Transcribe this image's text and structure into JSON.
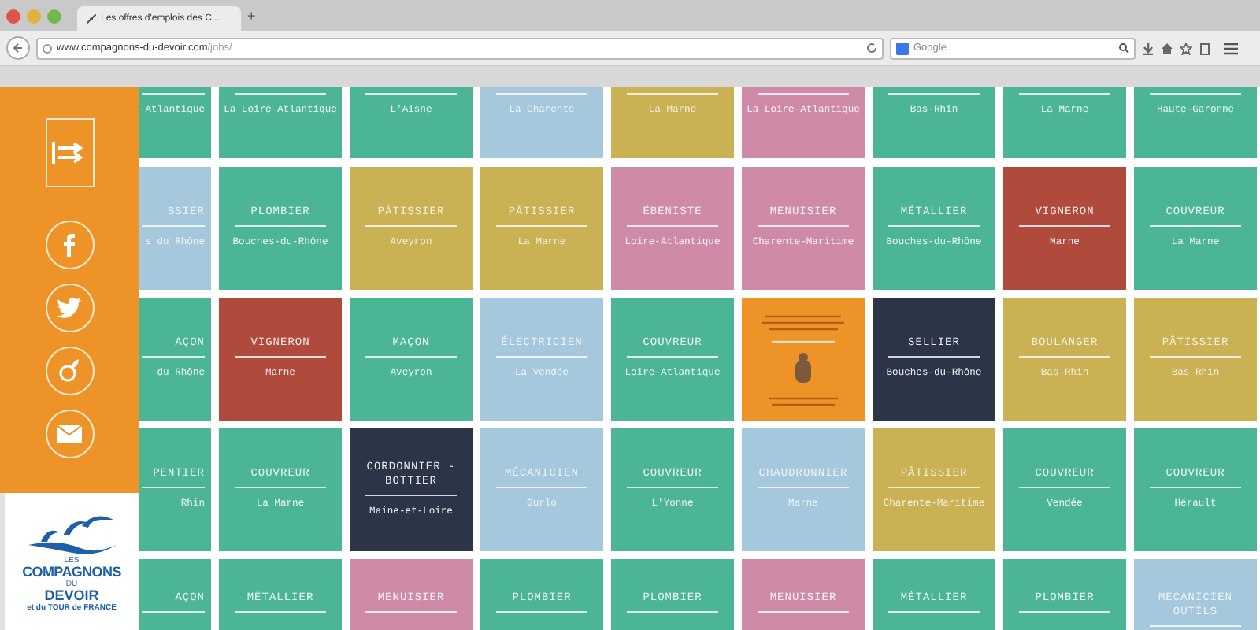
{
  "browser": {
    "tab_title": "Les offres d'emplois des C...",
    "new_tab": "+",
    "url_host": "www.compagnons-du-devoir.com",
    "url_path": "/jobs/",
    "search_placeholder": "Google"
  },
  "logo": {
    "lines": [
      "LES",
      "COMPAGNONS",
      "DU",
      "DEVOIR",
      "et du TOUR de FRANCE"
    ]
  },
  "rows": [
    {
      "kind": "bottom",
      "tiles": [
        {
          "kind": "job",
          "region": "-Atlantique",
          "color": "#4bb596"
        },
        {
          "kind": "job",
          "region": "La Loire-Atlantique",
          "color": "#4bb596"
        },
        {
          "kind": "job",
          "region": "L'Aisne",
          "color": "#4bb596"
        },
        {
          "kind": "job",
          "region": "La Charente",
          "color": "#a5c8dc"
        },
        {
          "kind": "job",
          "region": "La Marne",
          "color": "#c9b154"
        },
        {
          "kind": "job",
          "region": "La Loire-Atlantique",
          "color": "#cf8aa8"
        },
        {
          "kind": "job",
          "region": "Bas-Rhin",
          "color": "#4bb596"
        },
        {
          "kind": "job",
          "region": "La Marne",
          "color": "#4bb596"
        },
        {
          "kind": "job",
          "region": "Haute-Garonne",
          "color": "#4bb596"
        }
      ]
    },
    {
      "kind": "full",
      "tiles": [
        {
          "kind": "job",
          "title": "SSIER",
          "region": "s du Rhône",
          "color": "#a5c8dc"
        },
        {
          "kind": "job",
          "title": "PLOMBIER",
          "region": "Bouches-du-Rhône",
          "color": "#4bb596"
        },
        {
          "kind": "job",
          "title": "PÂTISSIER",
          "region": "Aveyron",
          "color": "#c9b154"
        },
        {
          "kind": "job",
          "title": "PÂTISSIER",
          "region": "La Marne",
          "color": "#c9b154"
        },
        {
          "kind": "job",
          "title": "ÉBÉNISTE",
          "region": "Loire-Atlantique",
          "color": "#cf8aa8"
        },
        {
          "kind": "job",
          "title": "MENUISIER",
          "region": "Charente-Maritime",
          "color": "#cf8aa8"
        },
        {
          "kind": "job",
          "title": "MÉTALLIER",
          "region": "Bouches-du-Rhône",
          "color": "#4bb596"
        },
        {
          "kind": "job",
          "title": "VIGNERON",
          "region": "Marne",
          "color": "#b04a3d"
        },
        {
          "kind": "job",
          "title": "COUVREUR",
          "region": "La Marne",
          "color": "#4bb596"
        }
      ]
    },
    {
      "kind": "full",
      "tiles": [
        {
          "kind": "job",
          "title": "AÇON",
          "region": "du Rhône",
          "color": "#4bb596"
        },
        {
          "kind": "job",
          "title": "VIGNERON",
          "region": "Marne",
          "color": "#b04a3d"
        },
        {
          "kind": "job",
          "title": "MAÇON",
          "region": "Aveyron",
          "color": "#4bb596"
        },
        {
          "kind": "job",
          "title": "ÉLECTRICIEN",
          "region": "La Vendée",
          "color": "#a5c8dc"
        },
        {
          "kind": "job",
          "title": "COUVREUR",
          "region": "Loire-Atlantique",
          "color": "#4bb596"
        },
        {
          "kind": "promo",
          "color": "#ee9328"
        },
        {
          "kind": "job",
          "title": "SELLIER",
          "region": "Bouches-du-Rhône",
          "color": "#2c3548"
        },
        {
          "kind": "job",
          "title": "BOULANGER",
          "region": "Bas-Rhin",
          "color": "#c9b154"
        },
        {
          "kind": "job",
          "title": "PÂTISSIER",
          "region": "Bas-Rhin",
          "color": "#c9b154"
        }
      ]
    },
    {
      "kind": "full",
      "tiles": [
        {
          "kind": "job",
          "title": "PENTIER",
          "region": "Rhin",
          "color": "#4bb596"
        },
        {
          "kind": "job",
          "title": "COUVREUR",
          "region": "La Marne",
          "color": "#4bb596"
        },
        {
          "kind": "job",
          "title": "CORDONNIER - BOTTIER",
          "region": "Maine-et-Loire",
          "color": "#2c3548"
        },
        {
          "kind": "job",
          "title": "MÉCANICIEN",
          "region": "Gurlo",
          "color": "#a5c8dc"
        },
        {
          "kind": "job",
          "title": "COUVREUR",
          "region": "L'Yonne",
          "color": "#4bb596"
        },
        {
          "kind": "job",
          "title": "CHAUDRONNIER",
          "region": "Marne",
          "color": "#a5c8dc"
        },
        {
          "kind": "job",
          "title": "PÂTISSIER",
          "region": "Charente-Maritime",
          "color": "#c9b154"
        },
        {
          "kind": "job",
          "title": "COUVREUR",
          "region": "Vendée",
          "color": "#4bb596"
        },
        {
          "kind": "job",
          "title": "COUVREUR",
          "region": "Hérault",
          "color": "#4bb596"
        }
      ]
    },
    {
      "kind": "top",
      "tiles": [
        {
          "kind": "job",
          "title": "AÇON",
          "color": "#4bb596"
        },
        {
          "kind": "job",
          "title": "MÉTALLIER",
          "color": "#4bb596"
        },
        {
          "kind": "job",
          "title": "MENUISIER",
          "color": "#cf8aa8"
        },
        {
          "kind": "job",
          "title": "PLOMBIER",
          "color": "#4bb596"
        },
        {
          "kind": "job",
          "title": "PLOMBIER",
          "color": "#4bb596"
        },
        {
          "kind": "job",
          "title": "MENUISIER",
          "color": "#cf8aa8"
        },
        {
          "kind": "job",
          "title": "MÉTALLIER",
          "color": "#4bb596"
        },
        {
          "kind": "job",
          "title": "PLOMBIER",
          "color": "#4bb596"
        },
        {
          "kind": "job",
          "title": "MÉCANICIEN OUTILS",
          "color": "#a5c8dc"
        }
      ]
    }
  ]
}
